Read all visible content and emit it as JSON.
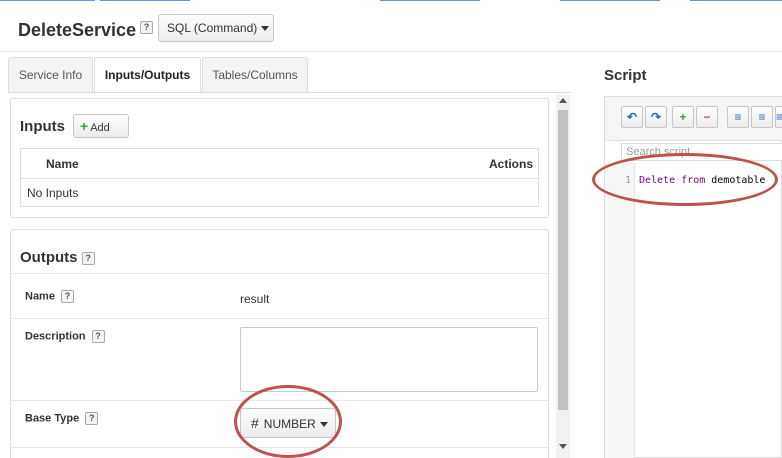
{
  "header": {
    "title": "DeleteService",
    "help": "?",
    "service_type": "SQL (Command)"
  },
  "tabs": [
    {
      "label": "Service Info",
      "active": false
    },
    {
      "label": "Inputs/Outputs",
      "active": true
    },
    {
      "label": "Tables/Columns",
      "active": false
    }
  ],
  "inputs": {
    "title": "Inputs",
    "add_label": "Add",
    "columns": [
      "Name",
      "Actions"
    ],
    "empty_text": "No Inputs"
  },
  "outputs": {
    "title": "Outputs",
    "help": "?",
    "name_label": "Name",
    "name_value": "result",
    "description_label": "Description",
    "description_value": "",
    "base_type_label": "Base Type",
    "base_type_value": "NUMBER",
    "base_type_icon": "#"
  },
  "script": {
    "title": "Script",
    "search_placeholder": "Search script",
    "line_number": "1",
    "code_kw1": "Delete",
    "code_mid": " ",
    "code_kw2": "from",
    "code_rest": " demotable"
  },
  "icons": {
    "undo": "undo-icon",
    "redo": "redo-icon",
    "add_snippet": "add-snippet-icon",
    "remove_snippet": "remove-snippet-icon",
    "indent": "indent-icon",
    "outdent": "outdent-icon"
  },
  "colors": {
    "highlight_circle": "#c0504d",
    "keyword": "#770088",
    "add_green": "#3aa63a"
  }
}
